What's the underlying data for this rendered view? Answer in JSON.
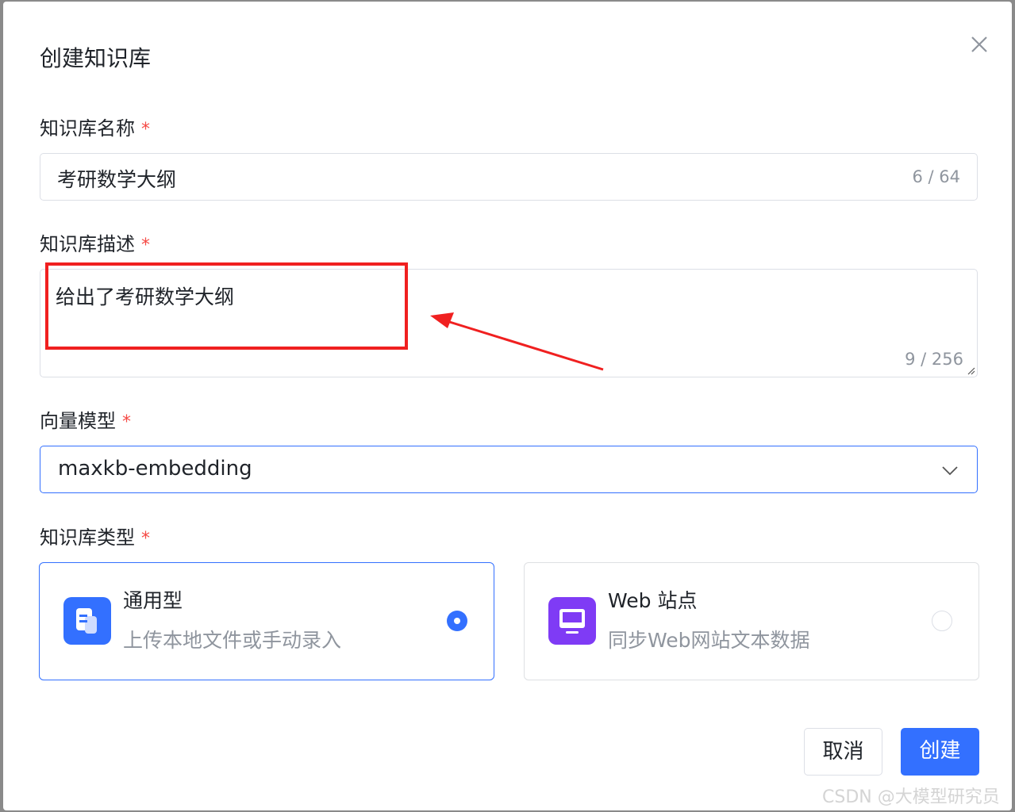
{
  "dialog": {
    "title": "创建知识库",
    "close_icon": "close-icon"
  },
  "form": {
    "required_mark": "*",
    "name": {
      "label": "知识库名称",
      "value": "考研数学大纲",
      "count": "6 / 64"
    },
    "description": {
      "label": "知识库描述",
      "value": "给出了考研数学大纲",
      "count": "9 / 256"
    },
    "model": {
      "label": "向量模型",
      "value": "maxkb-embedding",
      "icon": "chevron-down-icon"
    },
    "type": {
      "label": "知识库类型",
      "options": [
        {
          "title": "通用型",
          "desc": "上传本地文件或手动录入",
          "selected": true,
          "icon": "document-icon",
          "icon_color": "#3370ff"
        },
        {
          "title": "Web 站点",
          "desc": "同步Web网站文本数据",
          "selected": false,
          "icon": "monitor-icon",
          "icon_color": "#7f3bf5"
        }
      ]
    }
  },
  "footer": {
    "cancel_label": "取消",
    "create_label": "创建"
  },
  "annotation": {
    "color": "#f02020"
  },
  "watermark": "CSDN @大模型研究员",
  "colors": {
    "accent": "#3370ff",
    "required": "#f54a45"
  }
}
